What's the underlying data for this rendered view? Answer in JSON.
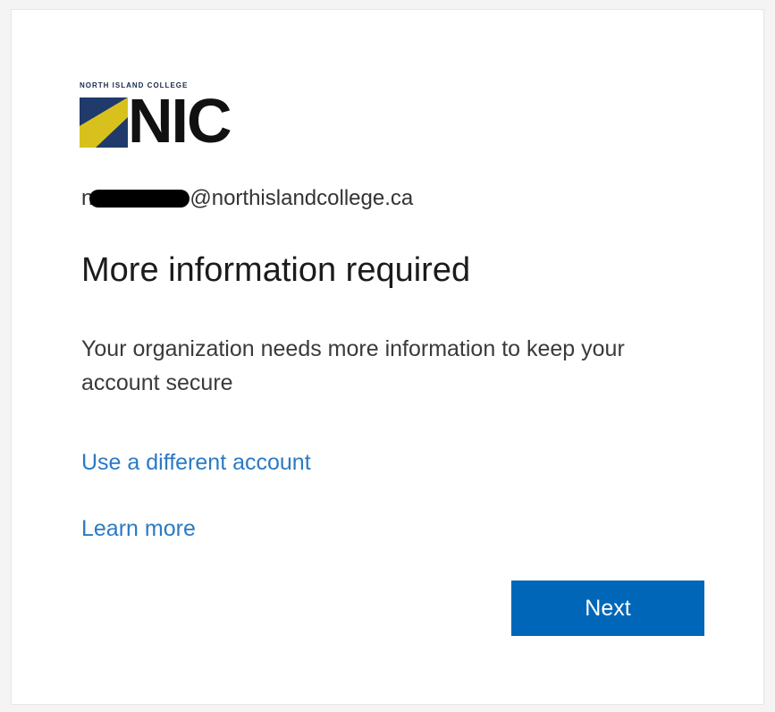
{
  "logo": {
    "college_name": "NORTH ISLAND COLLEGE",
    "wordmark": "NIC",
    "colors": {
      "navy": "#1f3a6b",
      "yellow": "#d8c11c",
      "text": "#111111"
    }
  },
  "account": {
    "prefix": "n",
    "domain": "@northislandcollege.ca"
  },
  "heading": "More information required",
  "description": "Your organization needs more information to keep your account secure",
  "links": {
    "different_account": "Use a different account",
    "learn_more": "Learn more"
  },
  "buttons": {
    "next": "Next"
  },
  "colors": {
    "link": "#2b7ac4",
    "primary_button": "#0067b8"
  }
}
